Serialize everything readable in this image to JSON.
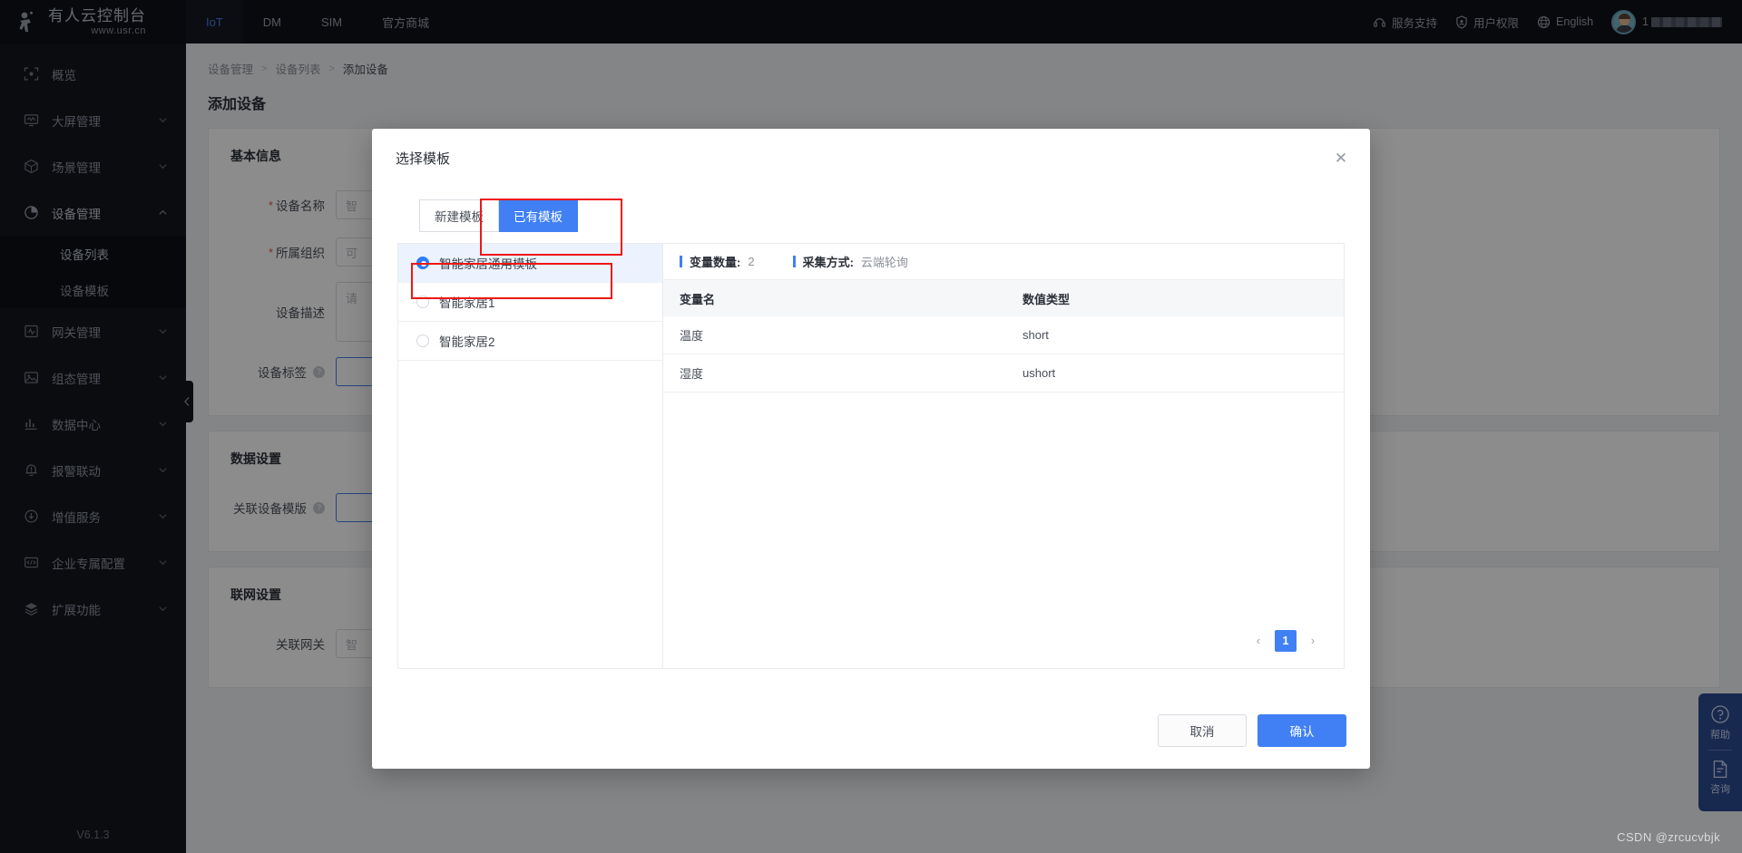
{
  "header": {
    "brand_title": "有人云控制台",
    "brand_sub": "www.usr.cn",
    "nav_tabs": [
      {
        "label": "IoT",
        "active": true
      },
      {
        "label": "DM",
        "active": false
      },
      {
        "label": "SIM",
        "active": false
      },
      {
        "label": "官方商城",
        "active": false
      }
    ],
    "support_label": "服务支持",
    "permission_label": "用户权限",
    "language_label": "English",
    "user_prefix": "1"
  },
  "sidebar": {
    "items": [
      {
        "label": "概览",
        "icon": "overview-icon",
        "expandable": false
      },
      {
        "label": "大屏管理",
        "icon": "screen-icon",
        "expandable": true
      },
      {
        "label": "场景管理",
        "icon": "cube-icon",
        "expandable": true
      },
      {
        "label": "设备管理",
        "icon": "pie-icon",
        "expandable": true,
        "open": true
      },
      {
        "label": "网关管理",
        "icon": "gateway-icon",
        "expandable": true
      },
      {
        "label": "组态管理",
        "icon": "image-icon",
        "expandable": true
      },
      {
        "label": "数据中心",
        "icon": "bar-chart-icon",
        "expandable": true
      },
      {
        "label": "报警联动",
        "icon": "bell-icon",
        "expandable": true
      },
      {
        "label": "增值服务",
        "icon": "coin-icon",
        "expandable": true
      },
      {
        "label": "企业专属配置",
        "icon": "code-icon",
        "expandable": true
      },
      {
        "label": "扩展功能",
        "icon": "layers-icon",
        "expandable": true
      }
    ],
    "sub_items": [
      {
        "label": "设备列表",
        "active": true
      },
      {
        "label": "设备模板",
        "active": false
      }
    ],
    "version": "V6.1.3"
  },
  "page": {
    "breadcrumb": [
      "设备管理",
      "设备列表",
      "添加设备"
    ],
    "title": "添加设备",
    "sections": [
      {
        "title": "基本信息",
        "fields": [
          {
            "label": "设备名称",
            "required": true,
            "help": false,
            "value": "智",
            "type": "input"
          },
          {
            "label": "所属组织",
            "required": true,
            "help": false,
            "value": "可",
            "type": "input"
          },
          {
            "label": "设备描述",
            "required": false,
            "help": false,
            "value": "请",
            "type": "textarea"
          },
          {
            "label": "设备标签",
            "required": false,
            "help": true,
            "value": "",
            "type": "input",
            "focused": true
          }
        ]
      },
      {
        "title": "数据设置",
        "fields": [
          {
            "label": "关联设备模版",
            "required": false,
            "help": true,
            "value": "",
            "type": "input",
            "focused": true
          }
        ]
      },
      {
        "title": "联网设置",
        "fields": [
          {
            "label": "关联网关",
            "required": false,
            "help": false,
            "value": "智",
            "type": "input"
          }
        ]
      }
    ]
  },
  "modal": {
    "title": "选择模板",
    "close_icon": "close-icon",
    "tabs": [
      {
        "label": "新建模板",
        "active": false
      },
      {
        "label": "已有模板",
        "active": true
      }
    ],
    "templates": [
      {
        "label": "智能家居通用模板",
        "selected": true
      },
      {
        "label": "智能家居1",
        "selected": false
      },
      {
        "label": "智能家居2",
        "selected": false
      }
    ],
    "meta": [
      {
        "key": "变量数量:",
        "value": "2"
      },
      {
        "key": "采集方式:",
        "value": "云端轮询"
      }
    ],
    "table": {
      "columns": [
        "变量名",
        "数值类型"
      ],
      "rows": [
        {
          "name": "温度",
          "type": "short"
        },
        {
          "name": "湿度",
          "type": "ushort"
        }
      ]
    },
    "pagination": {
      "prev": "‹",
      "pages": [
        "1"
      ],
      "next": "›",
      "current": "1"
    },
    "cancel_label": "取消",
    "confirm_label": "确认"
  },
  "fab": {
    "help_label": "帮助",
    "consult_label": "咨询"
  },
  "watermark": "CSDN @zrcucvbjk",
  "colors": {
    "primary": "#4080f4",
    "annotation": "#ef1616",
    "sidebar_bg": "#14161d",
    "header_bg": "#0f1117"
  }
}
